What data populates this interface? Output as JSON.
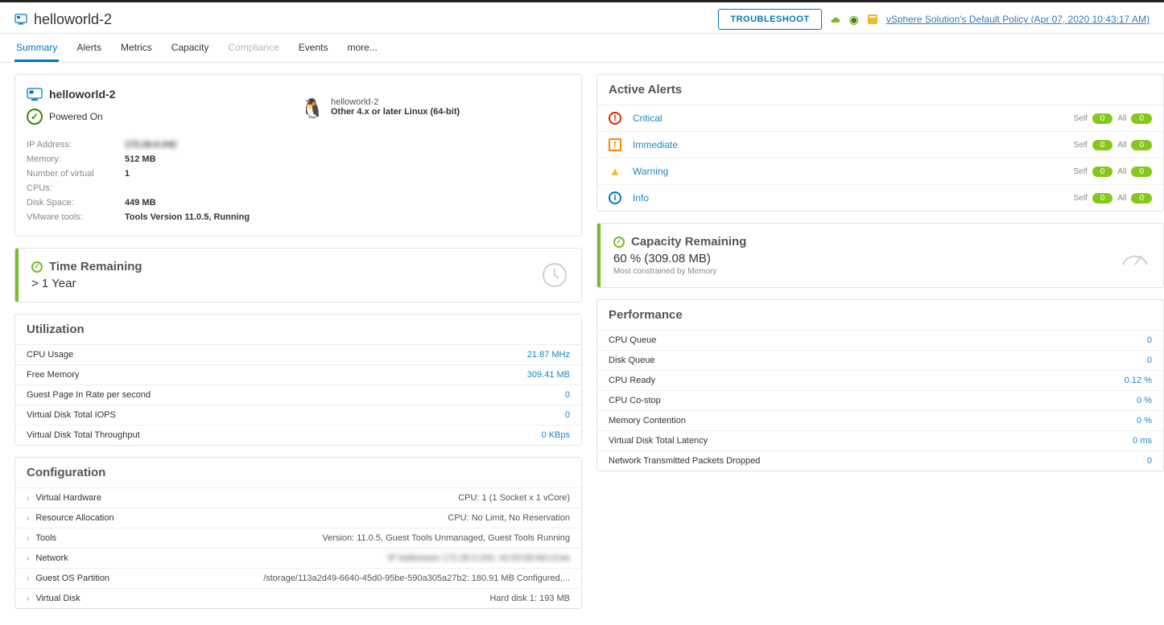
{
  "header": {
    "title": "helloworld-2",
    "troubleshoot": "TROUBLESHOOT",
    "policy": "vSphere Solution's Default Policy (Apr 07, 2020 10:43:17 AM)"
  },
  "tabs": {
    "summary": "Summary",
    "alerts": "Alerts",
    "metrics": "Metrics",
    "capacity": "Capacity",
    "compliance": "Compliance",
    "events": "Events",
    "more": "more..."
  },
  "summaryCard": {
    "name": "helloworld-2",
    "power": "Powered On",
    "props": {
      "ip_lbl": "IP Address:",
      "ip_val": "172.26.0.242",
      "mem_lbl": "Memory:",
      "mem_val": "512 MB",
      "cpu_lbl": "Number of virtual CPUs:",
      "cpu_val": "1",
      "disk_lbl": "Disk Space:",
      "disk_val": "449 MB",
      "tools_lbl": "VMware tools:",
      "tools_val": "Tools Version 11.0.5, Running"
    },
    "guest": {
      "name": "helloworld-2",
      "os": "Other 4.x or later Linux (64-bit)"
    }
  },
  "timeRemaining": {
    "title": "Time Remaining",
    "value": "> 1 Year"
  },
  "utilization": {
    "title": "Utilization",
    "rows": {
      "cpu_lbl": "CPU Usage",
      "cpu_val": "21.87 MHz",
      "mem_lbl": "Free Memory",
      "mem_val": "309.41 MB",
      "page_lbl": "Guest Page In Rate per second",
      "page_val": "0",
      "iops_lbl": "Virtual Disk Total IOPS",
      "iops_val": "0",
      "tput_lbl": "Virtual Disk Total Throughput",
      "tput_val": "0 KBps"
    }
  },
  "config": {
    "title": "Configuration",
    "rows": {
      "hw_lbl": "Virtual Hardware",
      "hw_val": "CPU: 1 (1 Socket x 1 vCore)",
      "res_lbl": "Resource Allocation",
      "res_val": "CPU: No Limit, No Reservation",
      "tools_lbl": "Tools",
      "tools_val": "Version: 11.0.5, Guest Tools Unmanaged, Guest Tools Running",
      "net_lbl": "Network",
      "net_val": "IP Addresses  172.26.0.242,  00:50:56:9d:c3:ee",
      "os_lbl": "Guest OS Partition",
      "os_val": "/storage/113a2d49-6640-45d0-95be-590a305a27b2: 180.91 MB Configured,...",
      "vd_lbl": "Virtual Disk",
      "vd_val": "Hard disk 1: 193 MB"
    }
  },
  "activeAlerts": {
    "title": "Active Alerts",
    "self_lbl": "Self",
    "all_lbl": "All",
    "zero": "0",
    "critical": "Critical",
    "immediate": "Immediate",
    "warning": "Warning",
    "info": "Info"
  },
  "capacityRemaining": {
    "title": "Capacity Remaining",
    "value": "60 % (309.08 MB)",
    "sub": "Most constrained by Memory"
  },
  "performance": {
    "title": "Performance",
    "rows": {
      "cpuq_lbl": "CPU Queue",
      "cpuq_val": "0",
      "diskq_lbl": "Disk Queue",
      "diskq_val": "0",
      "ready_lbl": "CPU Ready",
      "ready_val": "0.12 %",
      "costop_lbl": "CPU Co-stop",
      "costop_val": "0 %",
      "memc_lbl": "Memory Contention",
      "memc_val": "0 %",
      "lat_lbl": "Virtual Disk Total Latency",
      "lat_val": "0 ms",
      "pkt_lbl": "Network Transmitted Packets Dropped",
      "pkt_val": "0"
    }
  }
}
